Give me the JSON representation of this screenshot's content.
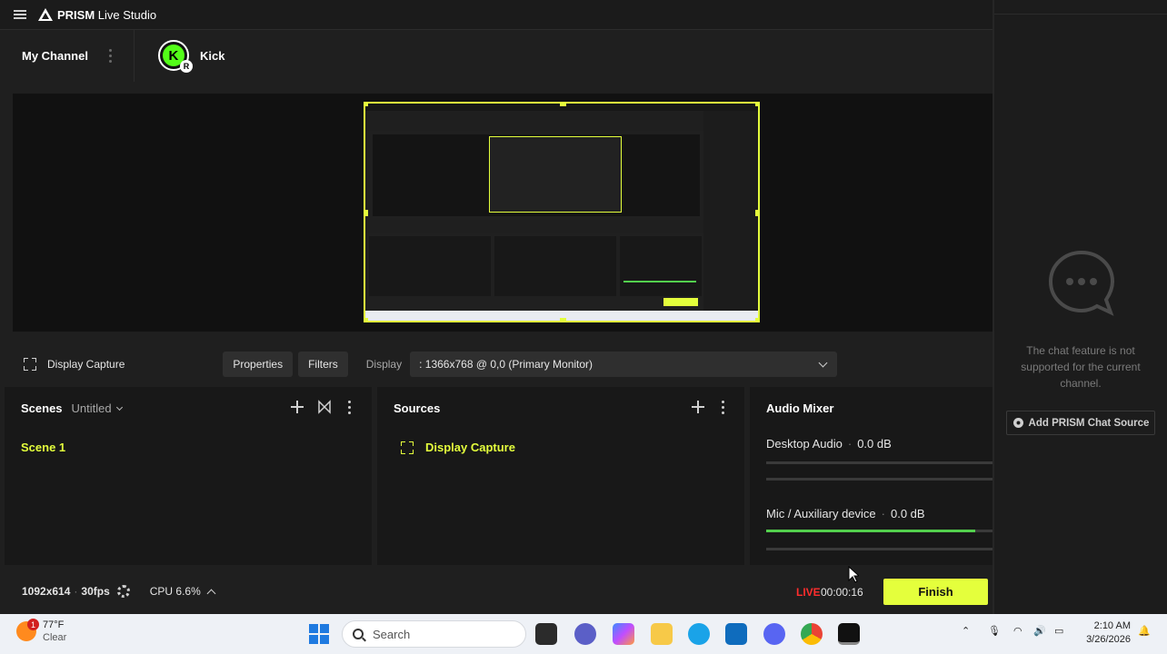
{
  "titlebar": {
    "app_title_bold": "PRISM",
    "app_title_rest": " Live Studio"
  },
  "channel_bar": {
    "my_channel": "My Channel",
    "platform_label": "Kick",
    "platform_initial": "K",
    "badge": "R"
  },
  "source_toolbar": {
    "source_name": "Display Capture",
    "properties_label": "Properties",
    "filters_label": "Filters",
    "display_label": "Display",
    "display_value": ": 1366x768 @ 0,0 (Primary Monitor)"
  },
  "scenes": {
    "title": "Scenes",
    "collection": "Untitled",
    "items": [
      "Scene 1"
    ]
  },
  "sources": {
    "title": "Sources",
    "items": [
      "Display Capture"
    ]
  },
  "audio_mixer": {
    "title": "Audio Mixer",
    "channels": [
      {
        "name": "Desktop Audio",
        "level": "0.0 dB",
        "meter": 0.0
      },
      {
        "name": "Mic / Auxiliary device",
        "level": "0.0 dB",
        "meter": 0.92
      }
    ]
  },
  "status_bar": {
    "resolution": "1092x614",
    "fps": "30fps",
    "cpu": "CPU 6.6%",
    "live_label": "LIVE",
    "timer": "00:00:16",
    "finish_label": "Finish"
  },
  "chat": {
    "message": "The chat feature is not supported for the current channel.",
    "add_button": "Add PRISM Chat Source"
  },
  "taskbar": {
    "weather_temp": "77°F",
    "weather_desc": "Clear",
    "weather_badge": "1",
    "search_placeholder": "Search",
    "time": "2:10 AM",
    "date": "3/26/2026"
  },
  "colors": {
    "accent": "#e4ff3c",
    "live": "#ff2d2d",
    "meter": "#53d04d",
    "kick": "#53fc18"
  },
  "icons": [
    "menu-icon",
    "prism-logo-icon",
    "display-capture-icon",
    "chevron-down-icon",
    "plus-icon",
    "transition-icon",
    "kebab-icon",
    "gear-icon",
    "chevron-up-icon",
    "chat-bubble-icon",
    "windows-icon",
    "search-icon"
  ]
}
